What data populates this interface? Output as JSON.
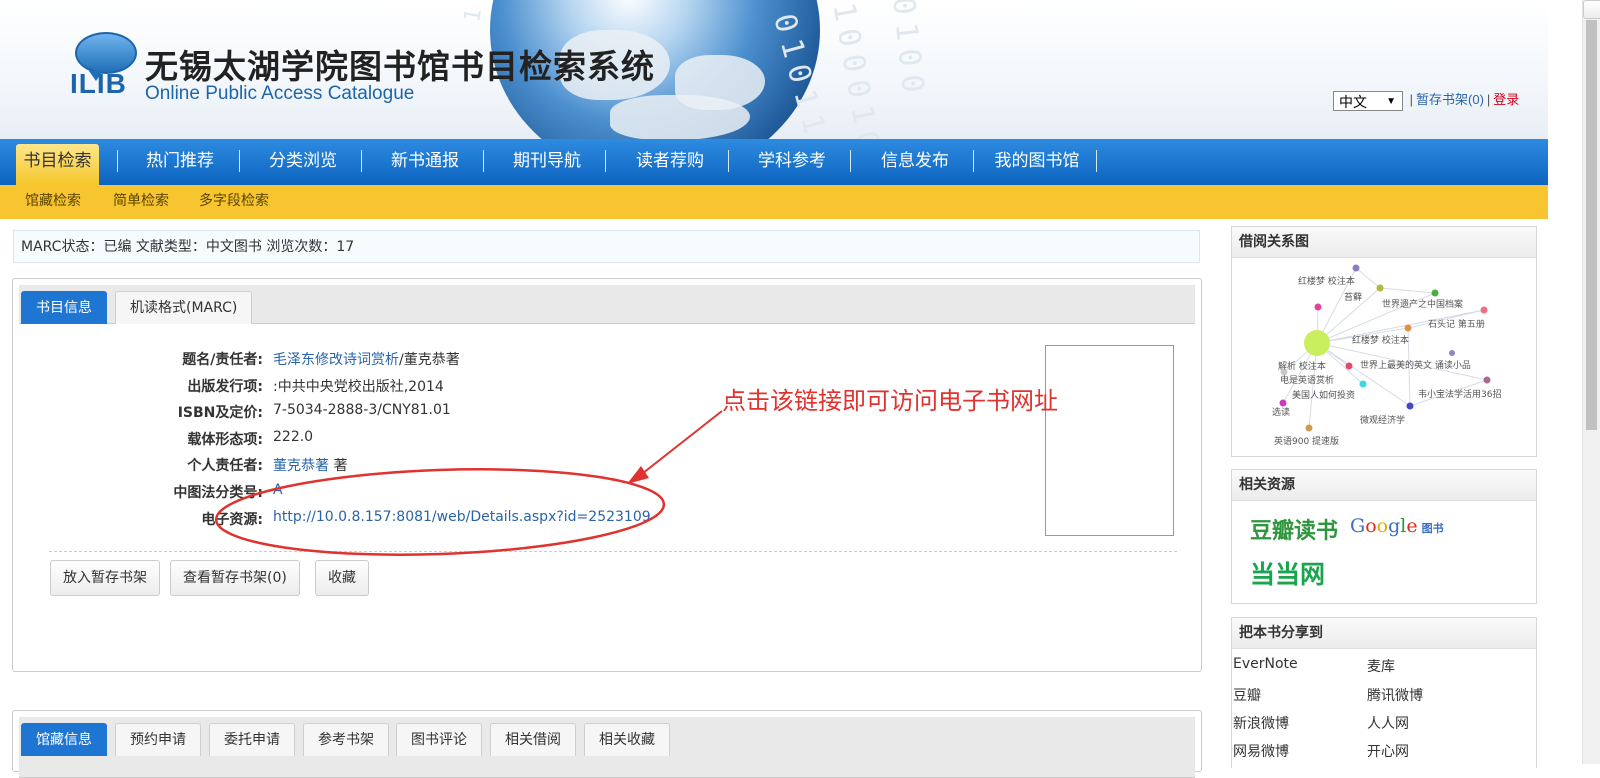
{
  "header": {
    "logo_text": "ILIB",
    "title": "无锡太湖学院图书馆书目检索系统",
    "subtitle": "Online Public Access Catalogue",
    "language": "中文",
    "shelf_link": "暂存书架(0)",
    "login_link": "登录"
  },
  "nav": {
    "items": [
      {
        "label": "书目检索"
      },
      {
        "label": "热门推荐"
      },
      {
        "label": "分类浏览"
      },
      {
        "label": "新书通报"
      },
      {
        "label": "期刊导航"
      },
      {
        "label": "读者荐购"
      },
      {
        "label": "学科参考"
      },
      {
        "label": "信息发布"
      },
      {
        "label": "我的图书馆"
      }
    ],
    "active_index": 0,
    "subnav": [
      {
        "label": "馆藏检索"
      },
      {
        "label": "简单检索"
      },
      {
        "label": "多字段检索"
      }
    ]
  },
  "status_line": "MARC状态：已编 文献类型：中文图书 浏览次数：17",
  "detail_tabs": [
    {
      "label": "书目信息"
    },
    {
      "label": "机读格式(MARC)"
    }
  ],
  "fields": {
    "title_label": "题名/责任者:",
    "title_link": "毛泽东修改诗词赏析",
    "title_rest": "/董克恭著",
    "publisher_label": "出版发行项:",
    "publisher_value": ":中共中央党校出版社,2014",
    "isbn_label": "ISBN及定价:",
    "isbn_value": "7-5034-2888-3/CNY81.01",
    "carrier_label": "载体形态项:",
    "carrier_value": "222.0",
    "author_label": "个人责任者:",
    "author_link": "董克恭著",
    "author_suffix": " 著",
    "clc_label": "中图法分类号:",
    "clc_value": "A",
    "eresource_label": "电子资源:",
    "eresource_url": "http://10.0.8.157:8081/web/Details.aspx?id=2523109"
  },
  "actions": {
    "add_shelf": "放入暂存书架",
    "view_shelf": "查看暂存书架(0)",
    "favorite": "收藏"
  },
  "annotation": "点击该链接即可访问电子书网址",
  "holding_tabs": [
    {
      "label": "馆藏信息"
    },
    {
      "label": "预约申请"
    },
    {
      "label": "委托申请"
    },
    {
      "label": "参考书架"
    },
    {
      "label": "图书评论"
    },
    {
      "label": "相关借阅"
    },
    {
      "label": "相关收藏"
    }
  ],
  "sidebar": {
    "graph_title": "借阅关系图",
    "graph_labels": [
      "红楼梦 校注本",
      "苔藓",
      "世界遗产之中国档案",
      "石头记 第五册",
      "红楼梦 校注本",
      "解析 校注本",
      "世界上最美的英文 诵读小品",
      "电是英语赏析",
      "美国人如何投资",
      "韦小宝法学活用36招",
      "选读",
      "微观经济学",
      "英语900 提速版"
    ],
    "related_title": "相关资源",
    "douban": "豆瓣读书",
    "google": "Google",
    "google_books": "图书",
    "dangdang": "当当网",
    "share_title": "把本书分享到",
    "share_items": [
      "EverNote",
      "麦库",
      "豆瓣",
      "腾讯微博",
      "新浪微博",
      "人人网",
      "网易微博",
      "开心网"
    ]
  },
  "colors": {
    "nav_blue": "#1677d2",
    "active_yellow": "#f6c72c",
    "subnav_yellow": "#f7c530",
    "link_blue": "#2a64a8",
    "annotation_red": "#e0322f"
  }
}
